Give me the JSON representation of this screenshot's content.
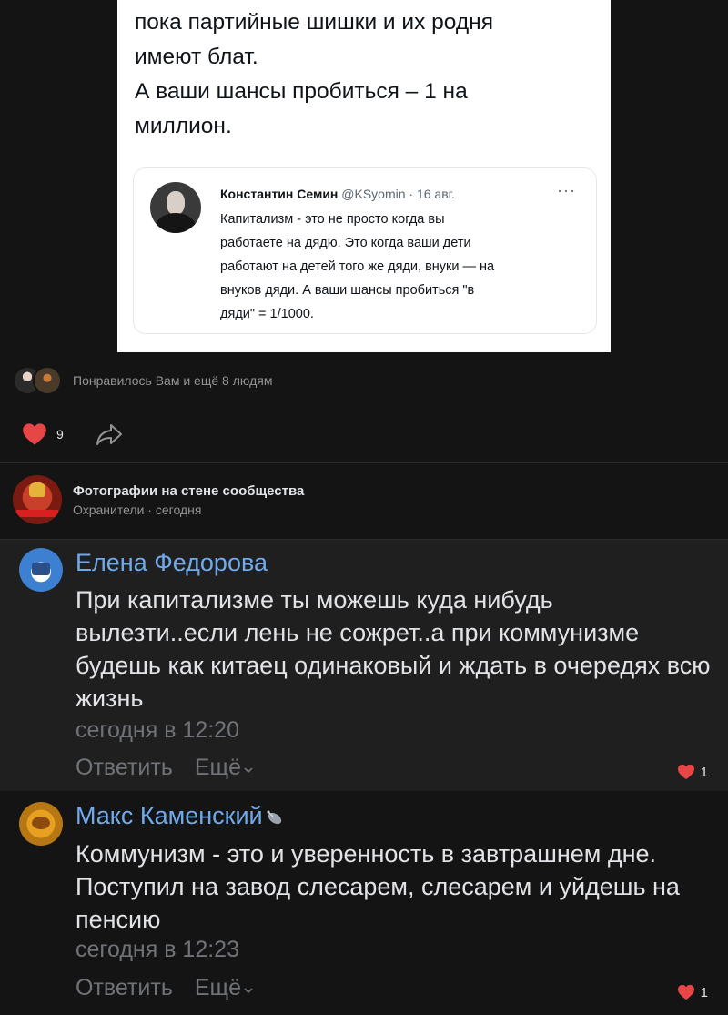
{
  "post": {
    "tweet_lines": [
      "пока партийные шишки и их родня",
      "имеют блат.",
      "А ваши шансы пробиться – 1 на",
      "миллион."
    ],
    "quote": {
      "author": "Константин Семин",
      "handle": "@KSyomin · 16 авг.",
      "more": "···",
      "text": "Капитализм - это не просто когда вы\nработаете на дядю. Это когда ваши дети\nработают на детей того же дяди, внуки — на\nвнуков дяди. А ваши шансы пробиться \"в\nдяди\" = 1/1000."
    }
  },
  "reactions": {
    "likers_text": "Понравилось Вам и ещё 8 людям",
    "like_count": "9",
    "like_color": "#e64646"
  },
  "source": {
    "title": "Фотографии на стене сообщества",
    "subtitle": "Охранители · сегодня"
  },
  "comments": [
    {
      "author": "Елена Федорова",
      "text": "При капитализме ты можешь куда нибудь вылезти..если лень не сожрет..а при коммунизме будешь как китаец одинаковый и ждать в очередях всю жизнь",
      "time": "сегодня в 12:20",
      "reply": "Ответить",
      "more": "Ещё",
      "likes": "1"
    },
    {
      "author": "Макс Каменский",
      "text": "Коммунизм - это и уверенность в завтрашнем дне. Поступил на завод слесарем, слесарем и уйдешь на пенсию",
      "time": "сегодня в 12:23",
      "reply": "Ответить",
      "more": "Ещё",
      "likes": "1"
    }
  ],
  "colors": {
    "background": "#141414",
    "comment_highlight": "#1f1f1f",
    "link": "#71aaeb",
    "muted": "#6f7377",
    "heart": "#e64646"
  },
  "icons": [
    "heart-icon",
    "share-icon",
    "chevron-down-icon",
    "satellite-icon",
    "more-dots-icon"
  ]
}
